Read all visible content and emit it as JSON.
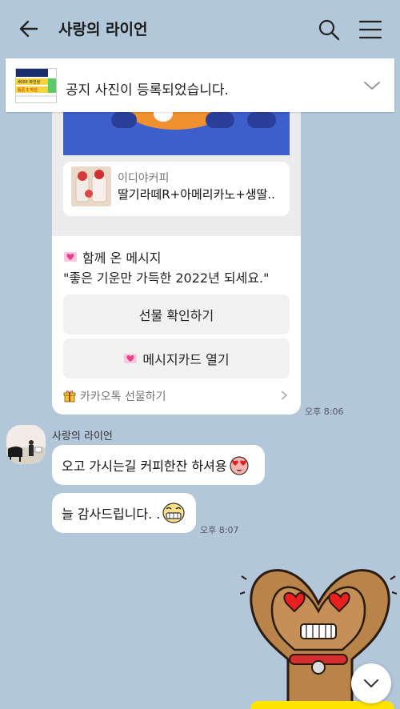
{
  "header": {
    "title": "사랑의 라이언"
  },
  "notice": {
    "text": "공지 사진이 등록되었습니다.",
    "thumb_line1": "4000 화천설",
    "thumb_line2": "틀존 1 자선"
  },
  "gift": {
    "brand": "이디야커피",
    "product": "딸기라떼R+아메리카노+생딸..",
    "message_header": "함께 온 메시지",
    "message_body": "\"좋은 기운만 가득한 2022년 되세요.\"",
    "check_button": "선물 확인하기",
    "card_button": "메시지카드 열기",
    "footer": "카카오톡 선물하기",
    "time": "오후 8:06"
  },
  "chat": {
    "sender": "사랑의 라이언",
    "messages": [
      {
        "text": "오고 가시는길 커피한잔 하셔용"
      },
      {
        "text": "늘 감사드립니다. ."
      }
    ],
    "time": "오후 8:07"
  },
  "colors": {
    "background": "#b2c7d9",
    "banner": "#3d5fcc",
    "kakao_yellow": "#fee500"
  },
  "icons": [
    "back-arrow-icon",
    "search-icon",
    "menu-icon",
    "chevron-down-icon",
    "heart-envelope-icon",
    "gift-box-icon",
    "chevron-right-icon",
    "heart-eyes-emoji",
    "grin-emoji"
  ]
}
